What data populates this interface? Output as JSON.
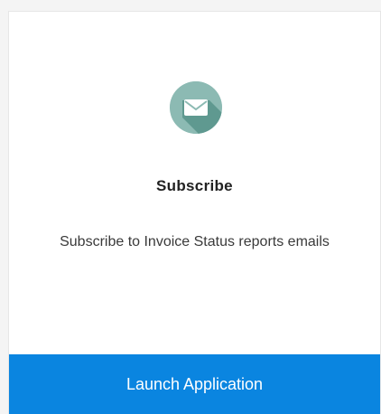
{
  "card": {
    "icon": "envelope-icon",
    "title": "Subscribe",
    "description": "Subscribe to Invoice Status reports emails",
    "launch_label": "Launch Application"
  },
  "colors": {
    "icon_circle": "#8cbab3",
    "icon_shadow": "#5f9990",
    "launch_button": "#0a85e0",
    "launch_text": "#ffffff",
    "title_text": "#222222"
  }
}
